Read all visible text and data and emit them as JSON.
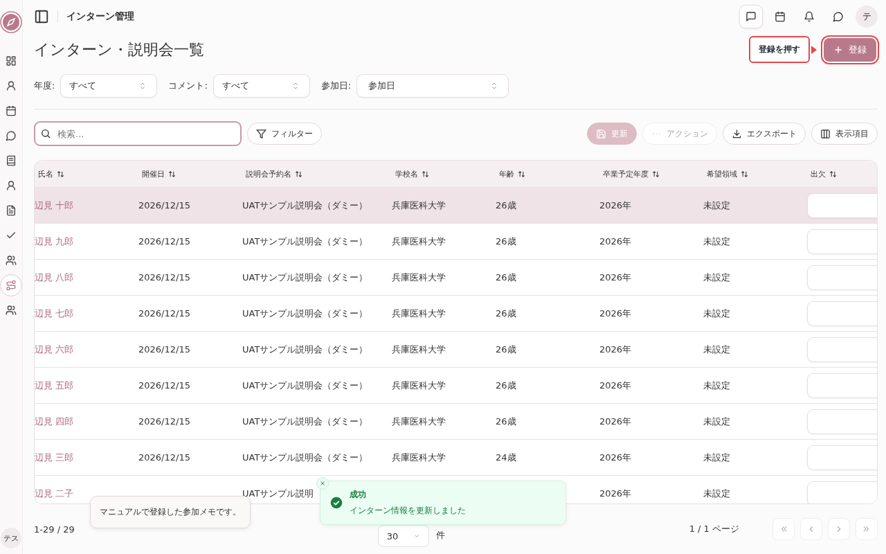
{
  "sidebar": {
    "items": [
      {
        "selected": false
      },
      {
        "selected": false
      },
      {
        "selected": false
      },
      {
        "selected": false
      },
      {
        "selected": false
      },
      {
        "selected": false
      },
      {
        "selected": false
      },
      {
        "selected": false
      },
      {
        "selected": false
      },
      {
        "selected": true
      },
      {
        "selected": false
      }
    ],
    "avatar": "テス"
  },
  "header": {
    "title": "インターン管理",
    "icons": [
      {
        "selected": true
      },
      {
        "selected": false
      },
      {
        "selected": false
      },
      {
        "selected": false
      }
    ],
    "avatar": "テ"
  },
  "page": {
    "title": "インターン・説明会一覧",
    "primary_button": "登録",
    "guide_tooltip": "登録を押す"
  },
  "filters": [
    {
      "label": "年度:",
      "value": "すべて"
    },
    {
      "label": "コメント:",
      "value": "すべて"
    },
    {
      "label": "参加日:",
      "value": "参加日"
    }
  ],
  "search": {
    "placeholder": "検索..."
  },
  "filter_button": "フィルター",
  "toolbar": [
    {
      "kind": "save",
      "label": "更新",
      "disabled": true
    },
    {
      "kind": "more",
      "label": "アクション",
      "disabled": true
    },
    {
      "kind": "export",
      "label": "エクスポート",
      "disabled": false
    },
    {
      "kind": "columns",
      "label": "表示項目",
      "disabled": false
    }
  ],
  "table": {
    "columns": [
      "氏名",
      "開催日",
      "説明会予約名",
      "学校名",
      "年齢",
      "卒業予定年度",
      "希望領域",
      "出欠"
    ],
    "rows": [
      {
        "selected": true,
        "cells": [
          "辺見 十郎",
          "2026/12/15",
          "UATサンプル説明会（ダミー）",
          "兵庫医科大学",
          "26歳",
          "2026年",
          "未設定"
        ]
      },
      {
        "selected": false,
        "cells": [
          "辺見 九郎",
          "2026/12/15",
          "UATサンプル説明会（ダミー）",
          "兵庫医科大学",
          "26歳",
          "2026年",
          "未設定"
        ]
      },
      {
        "selected": false,
        "cells": [
          "辺見 八郎",
          "2026/12/15",
          "UATサンプル説明会（ダミー）",
          "兵庫医科大学",
          "26歳",
          "2026年",
          "未設定"
        ]
      },
      {
        "selected": false,
        "cells": [
          "辺見 七郎",
          "2026/12/15",
          "UATサンプル説明会（ダミー）",
          "兵庫医科大学",
          "26歳",
          "2026年",
          "未設定"
        ]
      },
      {
        "selected": false,
        "cells": [
          "辺見 六郎",
          "2026/12/15",
          "UATサンプル説明会（ダミー）",
          "兵庫医科大学",
          "26歳",
          "2026年",
          "未設定"
        ]
      },
      {
        "selected": false,
        "cells": [
          "辺見 五郎",
          "2026/12/15",
          "UATサンプル説明会（ダミー）",
          "兵庫医科大学",
          "26歳",
          "2026年",
          "未設定"
        ]
      },
      {
        "selected": false,
        "cells": [
          "辺見 四郎",
          "2026/12/15",
          "UATサンプル説明会（ダミー）",
          "兵庫医科大学",
          "26歳",
          "2026年",
          "未設定"
        ]
      },
      {
        "selected": false,
        "cells": [
          "辺見 三郎",
          "2026/12/15",
          "UATサンプル説明会（ダミー）",
          "兵庫医科大学",
          "24歳",
          "2026年",
          "未設定"
        ]
      },
      {
        "selected": false,
        "cells": [
          "辺見 二子",
          null,
          "UATサンプル説明",
          null,
          null,
          "2026年",
          "未設定"
        ]
      }
    ]
  },
  "pagination": {
    "range": "1-29 / 29",
    "page_size": "30",
    "unit": "件",
    "page": "1 / 1 ページ",
    "nav": [
      {
        "kind": "first",
        "disabled": true
      },
      {
        "kind": "prev",
        "disabled": true
      },
      {
        "kind": "next",
        "disabled": true
      },
      {
        "kind": "last",
        "disabled": true
      }
    ]
  },
  "note_tooltip": "マニュアルで登録した参加メモです。",
  "toast": {
    "title": "成功",
    "message": "インターン情報を更新しました"
  }
}
